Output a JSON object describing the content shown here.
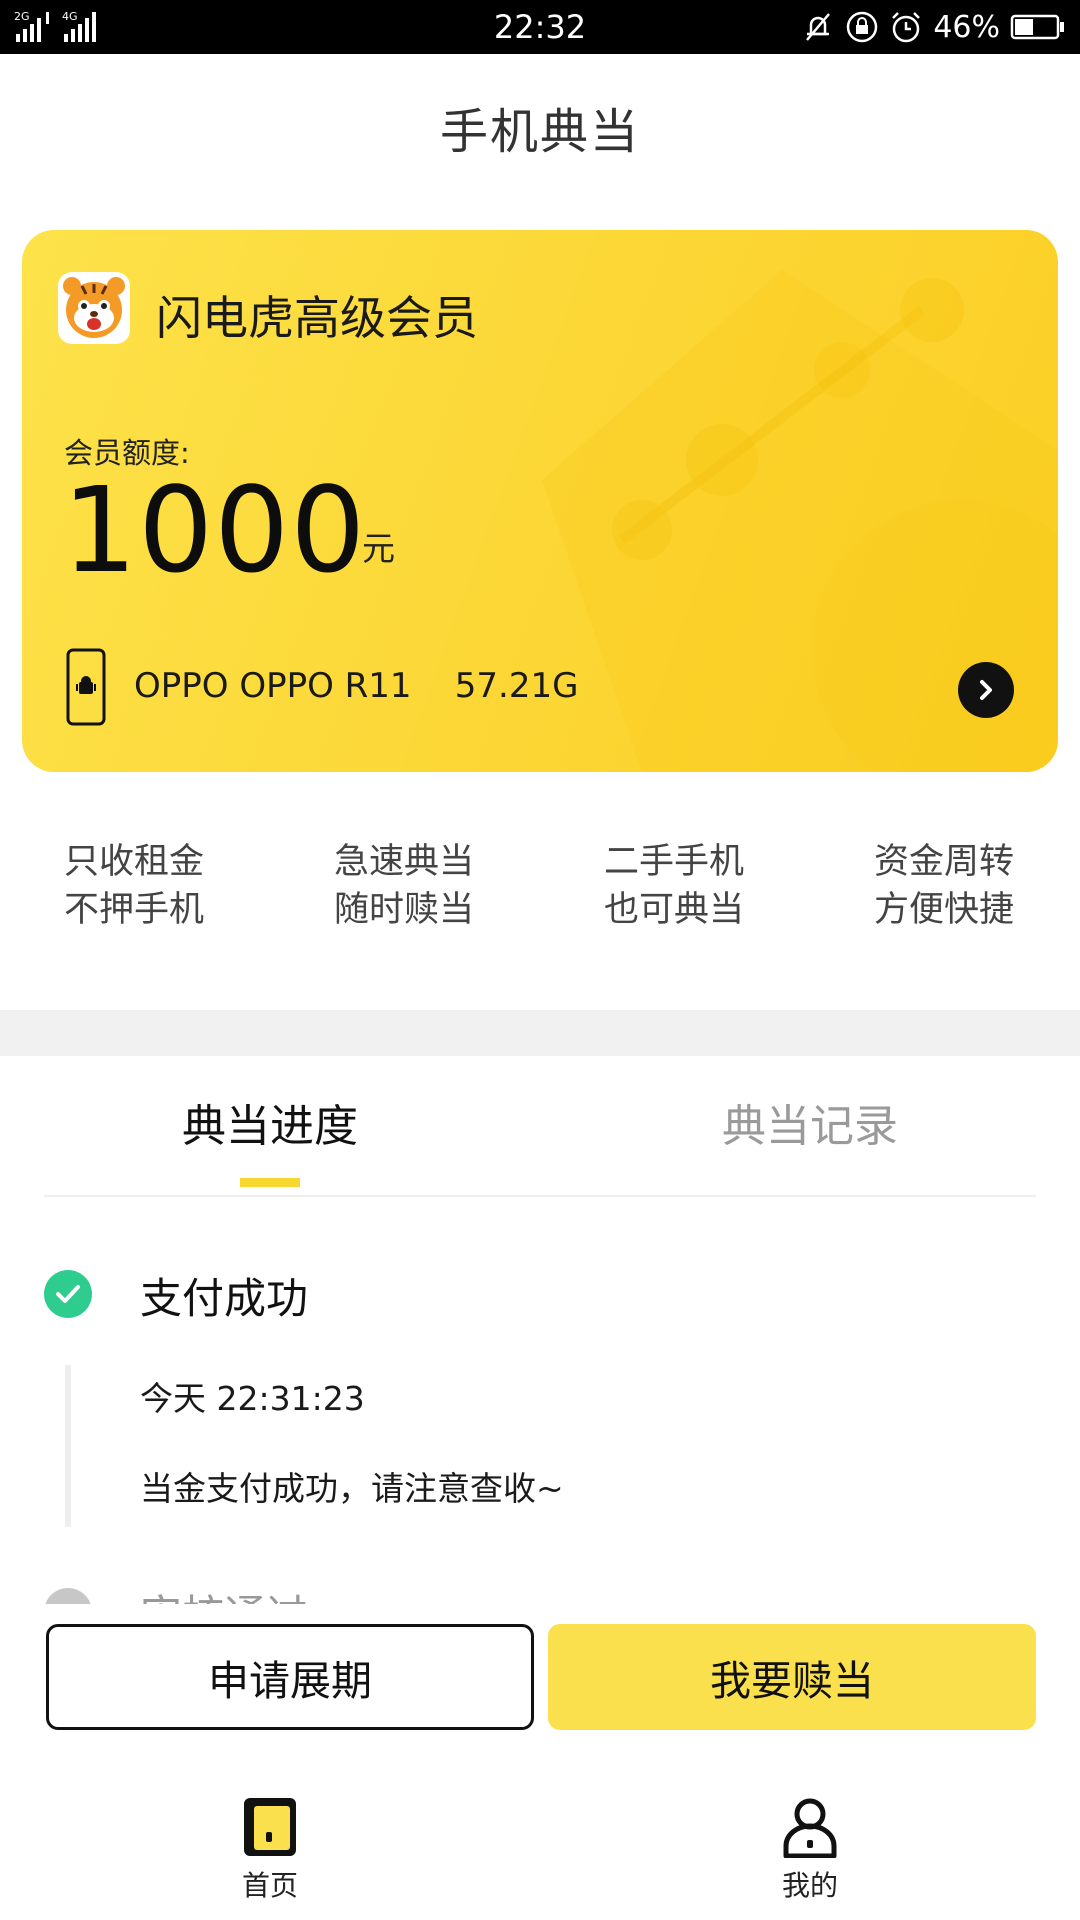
{
  "status_bar": {
    "network_left": "2G",
    "network_right": "4G",
    "time": "22:32",
    "battery_percent": "46%",
    "battery_level": 0.46,
    "icons": [
      "signal-icon",
      "mute-icon",
      "rotation-lock-icon",
      "alarm-icon",
      "battery-icon"
    ]
  },
  "header": {
    "title": "手机典当"
  },
  "card": {
    "title": "闪电虎高级会员",
    "quota_label": "会员额度:",
    "quota_value": "1000",
    "quota_unit": "元",
    "device": "OPPO OPPO R11    57.21G",
    "colors": {
      "start": "#fde24a",
      "end": "#fbcf24"
    }
  },
  "features": [
    {
      "line1": "只收租金",
      "line2": "不押手机"
    },
    {
      "line1": "急速典当",
      "line2": "随时赎当"
    },
    {
      "line1": "二手手机",
      "line2": "也可典当"
    },
    {
      "line1": "资金周转",
      "line2": "方便快捷"
    }
  ],
  "tabs": [
    {
      "label": "典当进度",
      "active": true
    },
    {
      "label": "典当记录",
      "active": false
    }
  ],
  "timeline": {
    "step1": {
      "title": "支付成功",
      "time": "今天 22:31:23",
      "desc": "当金支付成功，请注意查收~",
      "status_color": "#2ecc8f"
    },
    "step2": {
      "title": "审核通过"
    }
  },
  "actions": {
    "extend_label": "申请展期",
    "redeem_label": "我要赎当",
    "accent": "#fbe04e"
  },
  "bottom_nav": [
    {
      "label": "首页",
      "icon": "home-phone-icon"
    },
    {
      "label": "我的",
      "icon": "user-icon"
    }
  ]
}
